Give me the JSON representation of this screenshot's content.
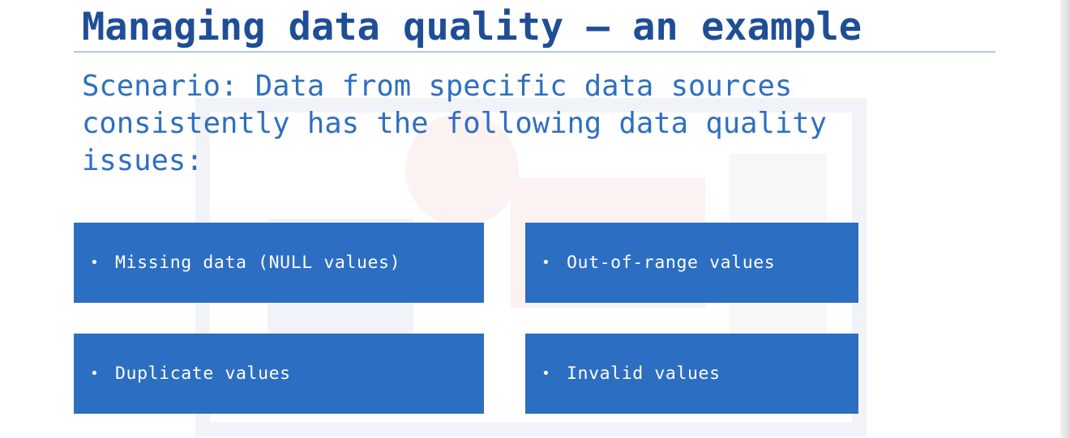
{
  "slide": {
    "title": "Managing data quality – an example",
    "scenario": "Scenario: Data from specific data sources consistently has the following data quality issues:"
  },
  "issues": [
    {
      "bullet": "•",
      "label": "Missing data (NULL values)"
    },
    {
      "bullet": "•",
      "label": "Out-of-range values"
    },
    {
      "bullet": "•",
      "label": "Duplicate values"
    },
    {
      "bullet": "•",
      "label": "Invalid values"
    }
  ],
  "colors": {
    "title": "#1f4e96",
    "scenario_text": "#2e6fc2",
    "box_fill": "#2c6ec1",
    "box_text": "#ffffff",
    "rule": "#b3c6e0"
  }
}
